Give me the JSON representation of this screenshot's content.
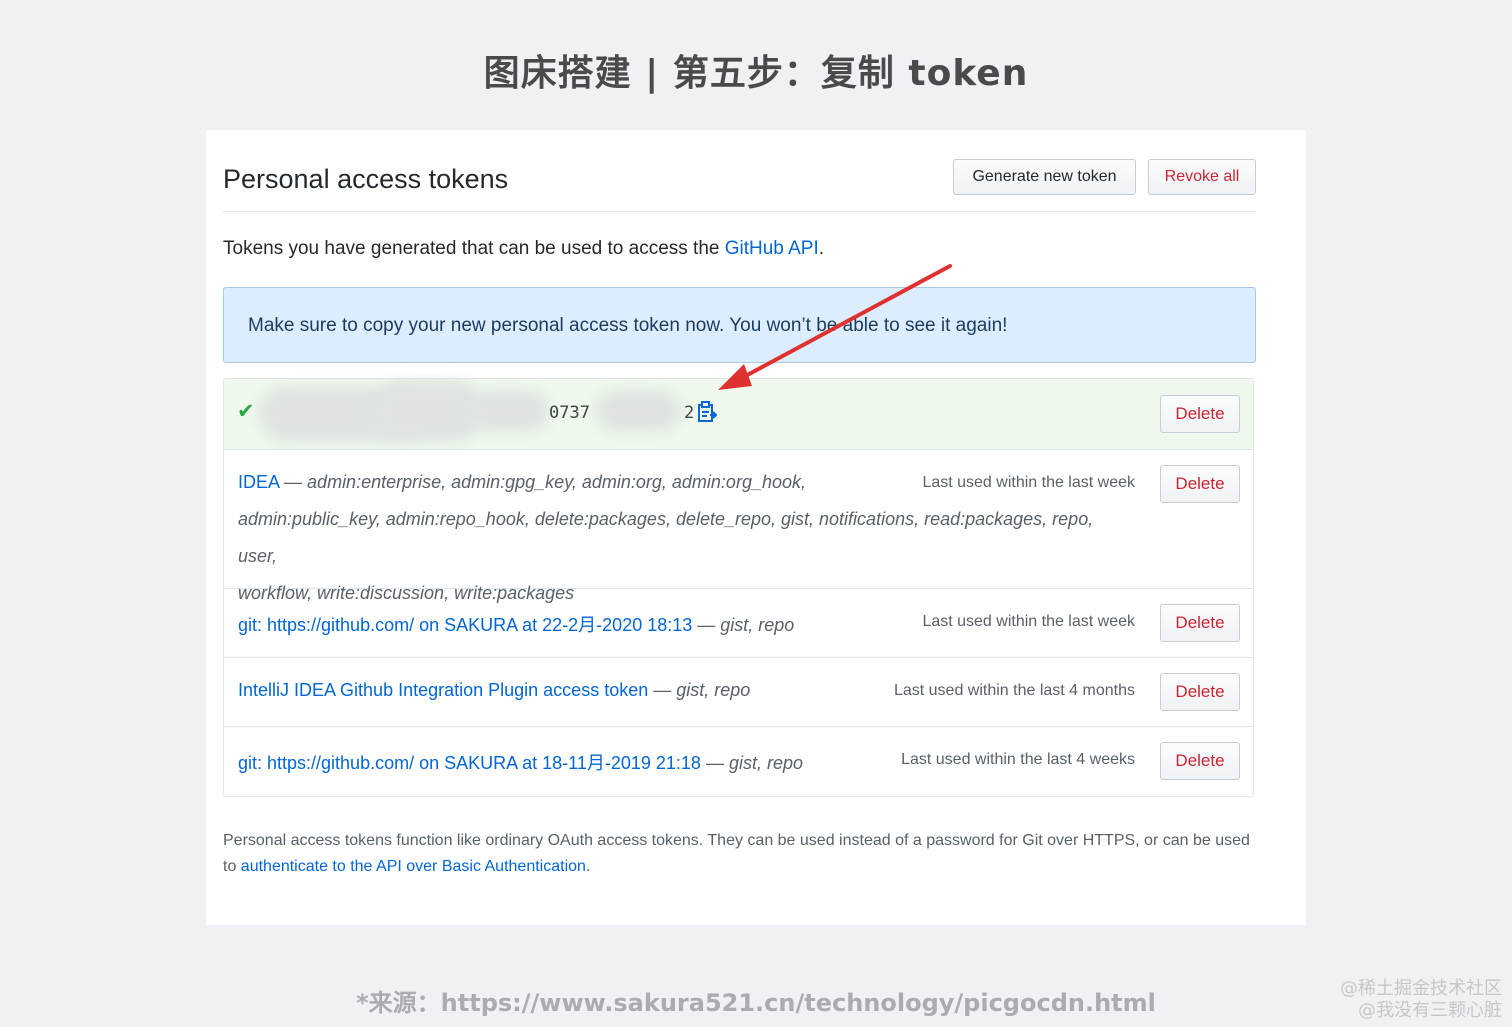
{
  "page_title": "图床搭建 | 第五步：复制 token",
  "header": {
    "title": "Personal access tokens",
    "generate_label": "Generate new token",
    "revoke_label": "Revoke all"
  },
  "intro": {
    "text": "Tokens you have generated that can be used to access the ",
    "link": "GitHub API",
    "end": "."
  },
  "flash": {
    "text": "Make sure to copy your new personal access token now. You won’t be able to see it again!"
  },
  "new_token": {
    "fragment_a": "0737",
    "fragment_b": "2",
    "delete_label": "Delete"
  },
  "tokens": [
    {
      "name": "IDEA",
      "scopes_line1": "admin:enterprise, admin:gpg_key, admin:org, admin:org_hook,",
      "scopes_line2": "admin:public_key, admin:repo_hook, delete:packages, delete_repo, gist, notifications, read:packages, repo, user,",
      "scopes_line3": "workflow, write:discussion, write:packages",
      "last_used": "Last used within the last week",
      "delete_label": "Delete"
    },
    {
      "name": "git: https://github.com/ on SAKURA at 22-2月-2020 18:13",
      "scopes": "gist, repo",
      "last_used": "Last used within the last week",
      "delete_label": "Delete"
    },
    {
      "name": "IntelliJ IDEA Github Integration Plugin access token",
      "scopes": "gist, repo",
      "last_used": "Last used within the last 4 months",
      "delete_label": "Delete"
    },
    {
      "name": "git: https://github.com/ on SAKURA at 18-11月-2019 21:18",
      "scopes": "gist, repo",
      "last_used": "Last used within the last 4 weeks",
      "delete_label": "Delete"
    }
  ],
  "dash": " — ",
  "footer": {
    "text": "Personal access tokens function like ordinary OAuth access tokens. They can be used instead of a password for Git over HTTPS, or can be used to ",
    "link": "authenticate to the API over Basic Authentication",
    "end": "."
  },
  "source": "*来源：https://www.sakura521.cn/technology/picgocdn.html",
  "watermark": {
    "line1": "@稀土掘金技术社区",
    "line2": "@我没有三颗心脏"
  },
  "colors": {
    "link": "#0366d6",
    "danger": "#cb2431",
    "arrow": "#e03131",
    "success": "#28a745"
  }
}
